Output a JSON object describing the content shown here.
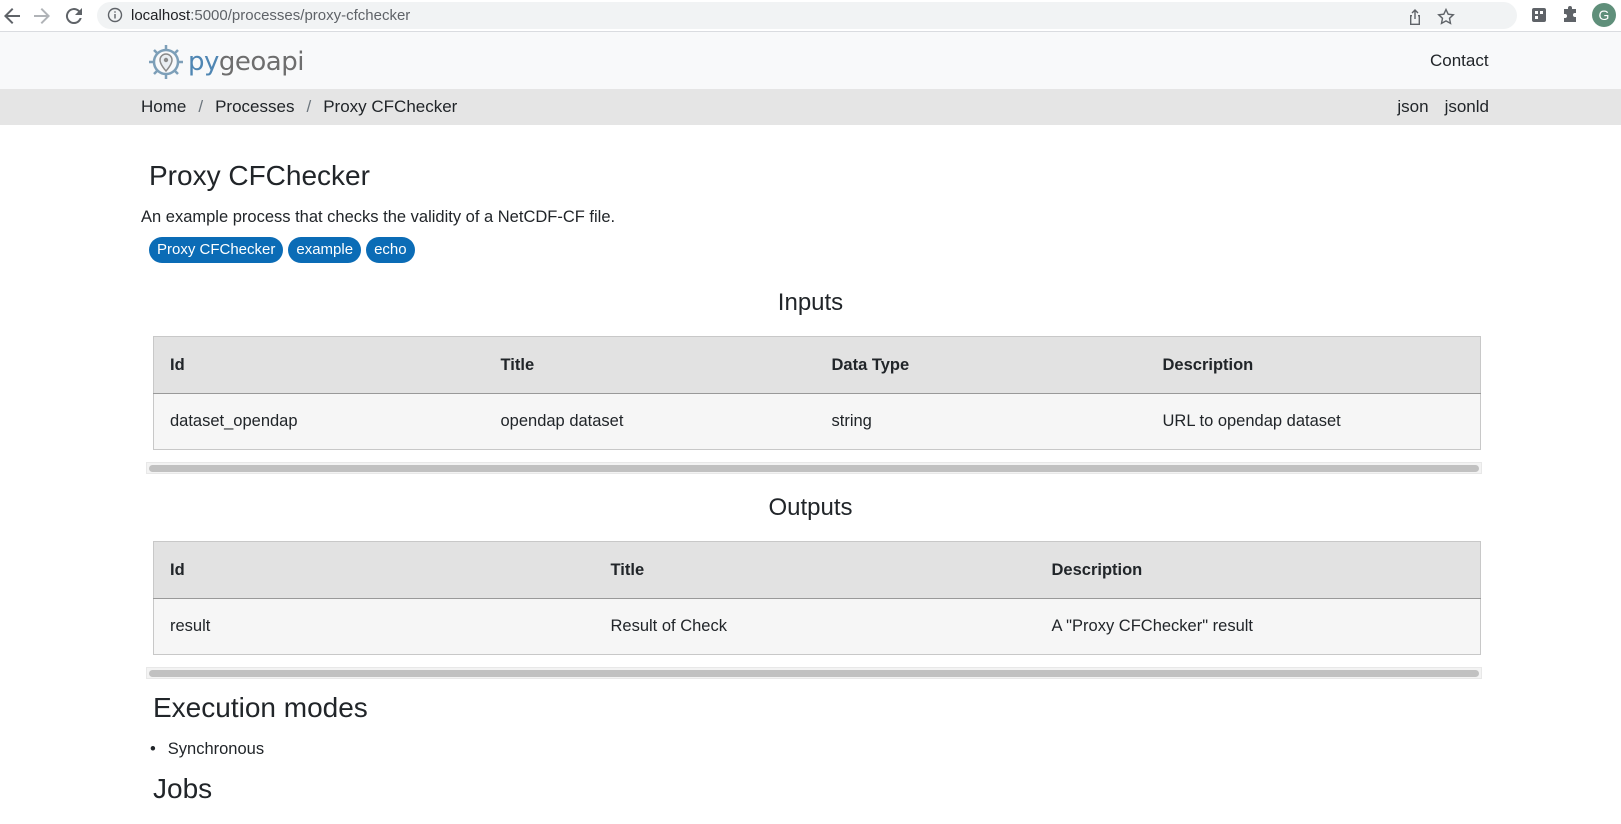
{
  "browser": {
    "url_host": "localhost",
    "url_path": ":5000/processes/proxy-cfchecker",
    "profile_initial": "G"
  },
  "header": {
    "logo_py": "py",
    "logo_geo": "geoapi",
    "contact": "Contact"
  },
  "breadcrumb": {
    "home": "Home",
    "processes": "Processes",
    "current": "Proxy CFChecker",
    "separator": "/"
  },
  "formats": {
    "json": "json",
    "jsonld": "jsonld"
  },
  "process": {
    "title": "Proxy CFChecker",
    "description": "An example process that checks the validity of a NetCDF-CF file.",
    "keywords": [
      "Proxy CFChecker",
      "example",
      "echo"
    ]
  },
  "inputs": {
    "title": "Inputs",
    "headers": [
      "Id",
      "Title",
      "Data Type",
      "Description"
    ],
    "rows": [
      [
        "dataset_opendap",
        "opendap dataset",
        "string",
        "URL to opendap dataset"
      ]
    ]
  },
  "outputs": {
    "title": "Outputs",
    "headers": [
      "Id",
      "Title",
      "Description"
    ],
    "rows": [
      [
        "result",
        "Result of Check",
        "A \"Proxy CFChecker\" result"
      ]
    ]
  },
  "execution_modes": {
    "title": "Execution modes",
    "items": [
      "Synchronous"
    ]
  },
  "jobs": {
    "title": "Jobs"
  },
  "colors": {
    "badge": "#0b6cb6",
    "header_bg": "#f8f9fa",
    "crumb_bg": "#e5e5e5"
  }
}
